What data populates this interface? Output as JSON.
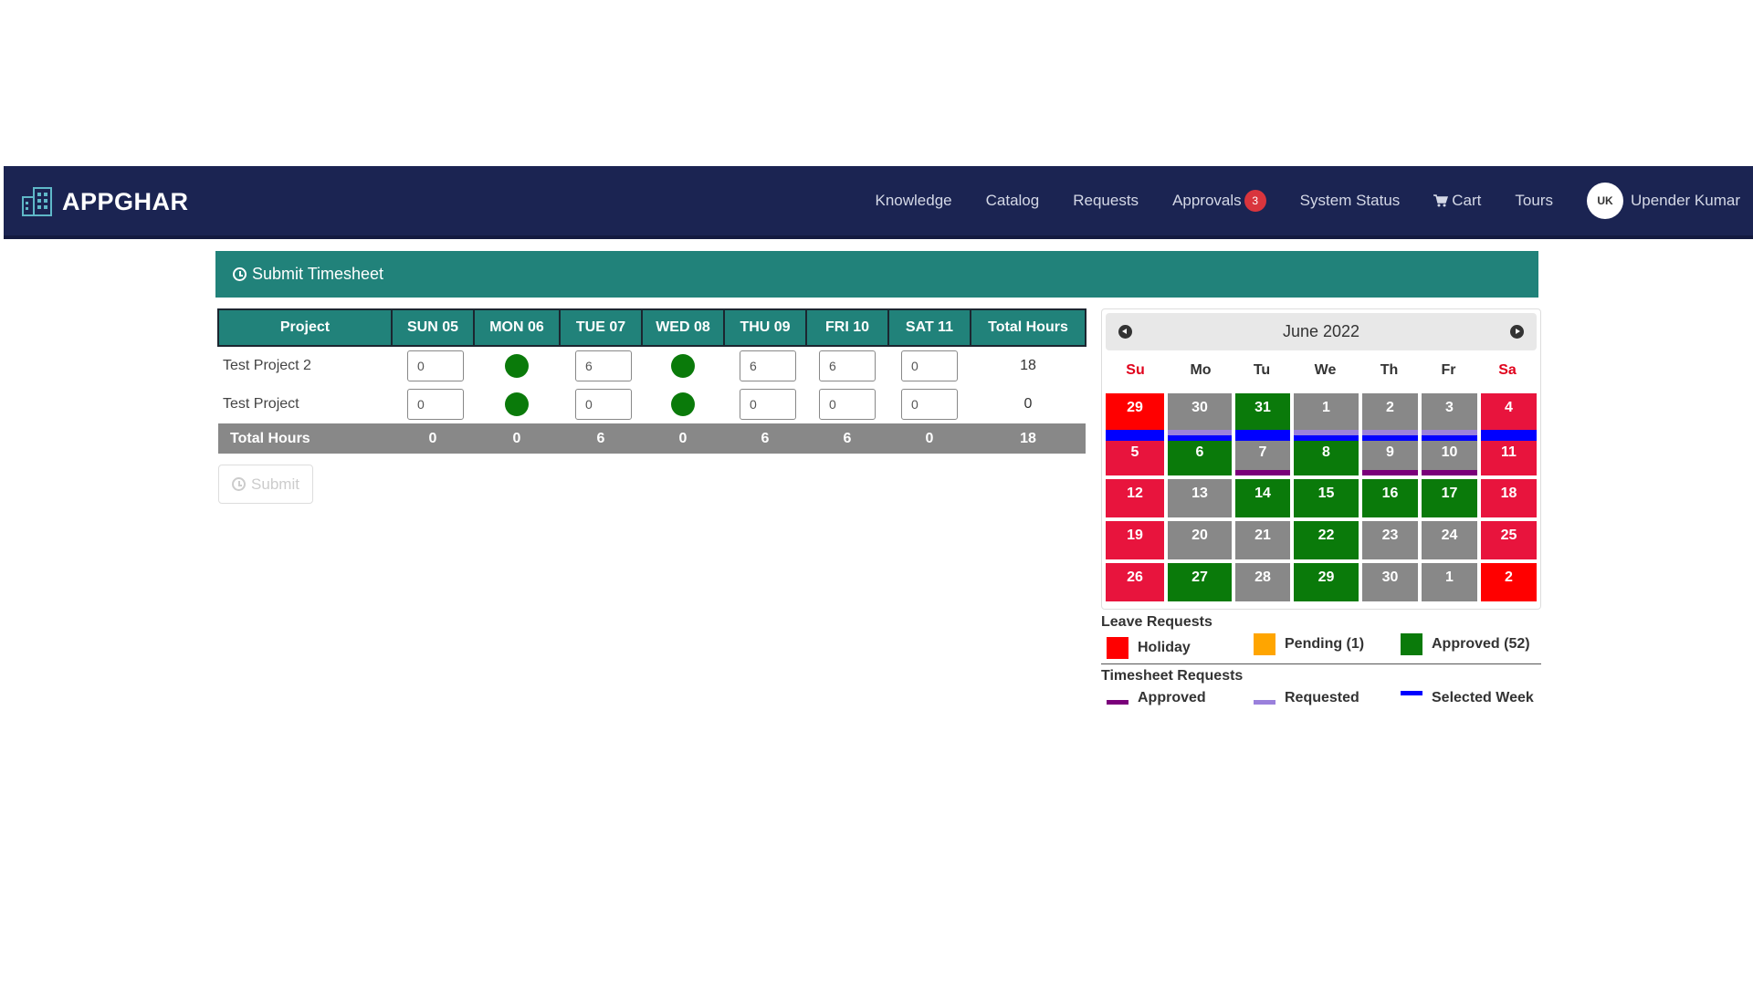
{
  "navbar": {
    "brand": "APPGHAR",
    "items": [
      {
        "label": "Knowledge"
      },
      {
        "label": "Catalog"
      },
      {
        "label": "Requests"
      },
      {
        "label": "Approvals",
        "badge": "3"
      },
      {
        "label": "System Status"
      },
      {
        "label": "Cart",
        "icon": "cart-icon"
      },
      {
        "label": "Tours"
      }
    ],
    "user": {
      "initials": "UK",
      "name": "Upender Kumar"
    }
  },
  "panel": {
    "title": "Submit Timesheet",
    "icon": "clock-icon"
  },
  "timesheet": {
    "headers": [
      "Project",
      "SUN 05",
      "MON 06",
      "TUE 07",
      "WED 08",
      "THU 09",
      "FRI 10",
      "SAT 11",
      "Total Hours"
    ],
    "rows": [
      {
        "project": "Test Project 2",
        "sun": "0",
        "mon": "holiday-dot",
        "tue": "6",
        "wed": "holiday-dot",
        "thu": "6",
        "fri": "6",
        "sat": "0",
        "total": "18"
      },
      {
        "project": "Test Project",
        "sun": "0",
        "mon": "holiday-dot",
        "tue": "0",
        "wed": "holiday-dot",
        "thu": "0",
        "fri": "0",
        "sat": "0",
        "total": "0"
      }
    ],
    "totals": {
      "label": "Total Hours",
      "values": [
        "0",
        "0",
        "6",
        "0",
        "6",
        "6",
        "0",
        "18"
      ]
    },
    "dot_color": "#0a7a0a"
  },
  "submit": {
    "label": "Submit"
  },
  "calendar": {
    "title": "June 2022",
    "dow": [
      "Su",
      "Mo",
      "Tu",
      "We",
      "Th",
      "Fr",
      "Sa"
    ],
    "weeks": [
      [
        "29",
        "30",
        "31",
        "1",
        "2",
        "3",
        "4"
      ],
      [
        "5",
        "6",
        "7",
        "8",
        "9",
        "10",
        "11"
      ],
      [
        "12",
        "13",
        "14",
        "15",
        "16",
        "17",
        "18"
      ],
      [
        "19",
        "20",
        "21",
        "22",
        "23",
        "24",
        "25"
      ],
      [
        "26",
        "27",
        "28",
        "29",
        "30",
        "1",
        "2"
      ]
    ],
    "colors": {
      "holiday": "#e8143d",
      "holiday_bright": "#ff0000",
      "workday": "#888888",
      "approved": "#0a7a0a",
      "selected_week": "#0000ff",
      "ts_approved": "#7a007a",
      "ts_requested": "#9a80dc"
    }
  },
  "legend": {
    "leave_title": "Leave Requests",
    "holiday": "Holiday",
    "pending": "Pending (1)",
    "approved": "Approved (52)",
    "timesheet_title": "Timesheet Requests",
    "ts_approved": "Approved",
    "ts_requested": "Requested",
    "selected_week": "Selected Week",
    "colors": {
      "holiday": "#ff0000",
      "pending": "#ffa500",
      "approved": "#0a7a0a",
      "ts_approved": "#7a007a",
      "ts_requested": "#9a80dc",
      "selected_week": "#0000ff"
    }
  }
}
